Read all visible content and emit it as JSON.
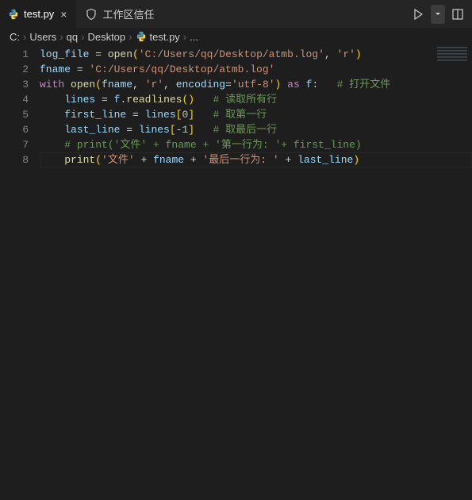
{
  "tab": {
    "filename": "test.py",
    "trust_label": "工作区信任"
  },
  "breadcrumbs": [
    "C:",
    "Users",
    "qq",
    "Desktop",
    "test.py",
    "..."
  ],
  "code": {
    "lines": [
      {
        "n": 1,
        "tokens": [
          {
            "t": "log_file",
            "c": "tok-var"
          },
          {
            "t": " = ",
            "c": "tok-op"
          },
          {
            "t": "open",
            "c": "tok-func"
          },
          {
            "t": "(",
            "c": "tok-pun"
          },
          {
            "t": "'C:/Users/qq/Desktop/atmb.log'",
            "c": "tok-str"
          },
          {
            "t": ", ",
            "c": "tok-op"
          },
          {
            "t": "'r'",
            "c": "tok-str"
          },
          {
            "t": ")",
            "c": "tok-pun"
          }
        ]
      },
      {
        "n": 2,
        "tokens": [
          {
            "t": "fname",
            "c": "tok-var"
          },
          {
            "t": " = ",
            "c": "tok-op"
          },
          {
            "t": "'C:/Users/qq/Desktop/atmb.log'",
            "c": "tok-str"
          }
        ]
      },
      {
        "n": 3,
        "tokens": [
          {
            "t": "with",
            "c": "tok-kw"
          },
          {
            "t": " ",
            "c": "tok-op"
          },
          {
            "t": "open",
            "c": "tok-func"
          },
          {
            "t": "(",
            "c": "tok-pun"
          },
          {
            "t": "fname",
            "c": "tok-var"
          },
          {
            "t": ", ",
            "c": "tok-op"
          },
          {
            "t": "'r'",
            "c": "tok-str"
          },
          {
            "t": ", ",
            "c": "tok-op"
          },
          {
            "t": "encoding",
            "c": "tok-var"
          },
          {
            "t": "=",
            "c": "tok-op"
          },
          {
            "t": "'utf-8'",
            "c": "tok-str"
          },
          {
            "t": ")",
            "c": "tok-pun"
          },
          {
            "t": " ",
            "c": "tok-op"
          },
          {
            "t": "as",
            "c": "tok-kw"
          },
          {
            "t": " ",
            "c": "tok-op"
          },
          {
            "t": "f",
            "c": "tok-var"
          },
          {
            "t": ":",
            "c": "tok-op"
          },
          {
            "t": "   ",
            "c": "tok-op"
          },
          {
            "t": "# 打开文件",
            "c": "tok-comment"
          }
        ]
      },
      {
        "n": 4,
        "tokens": [
          {
            "t": "    ",
            "c": "indent"
          },
          {
            "t": "lines",
            "c": "tok-var"
          },
          {
            "t": " = ",
            "c": "tok-op"
          },
          {
            "t": "f",
            "c": "tok-var"
          },
          {
            "t": ".",
            "c": "tok-op"
          },
          {
            "t": "readlines",
            "c": "tok-func"
          },
          {
            "t": "()",
            "c": "tok-pun"
          },
          {
            "t": "   ",
            "c": "tok-op"
          },
          {
            "t": "# 读取所有行",
            "c": "tok-comment"
          }
        ]
      },
      {
        "n": 5,
        "tokens": [
          {
            "t": "    ",
            "c": "indent"
          },
          {
            "t": "first_line",
            "c": "tok-var"
          },
          {
            "t": " = ",
            "c": "tok-op"
          },
          {
            "t": "lines",
            "c": "tok-var"
          },
          {
            "t": "[",
            "c": "tok-pun"
          },
          {
            "t": "0",
            "c": "tok-num"
          },
          {
            "t": "]",
            "c": "tok-pun"
          },
          {
            "t": "   ",
            "c": "tok-op"
          },
          {
            "t": "# 取第一行",
            "c": "tok-comment"
          }
        ]
      },
      {
        "n": 6,
        "tokens": [
          {
            "t": "    ",
            "c": "indent"
          },
          {
            "t": "last_line",
            "c": "tok-var"
          },
          {
            "t": " = ",
            "c": "tok-op"
          },
          {
            "t": "lines",
            "c": "tok-var"
          },
          {
            "t": "[",
            "c": "tok-pun"
          },
          {
            "t": "-",
            "c": "tok-op"
          },
          {
            "t": "1",
            "c": "tok-num"
          },
          {
            "t": "]",
            "c": "tok-pun"
          },
          {
            "t": "   ",
            "c": "tok-op"
          },
          {
            "t": "# 取最后一行",
            "c": "tok-comment"
          }
        ]
      },
      {
        "n": 7,
        "tokens": [
          {
            "t": "    ",
            "c": "indent"
          },
          {
            "t": "# print('文件' + fname + '第一行为: '+ first_line)",
            "c": "tok-comment"
          }
        ]
      },
      {
        "n": 8,
        "tokens": [
          {
            "t": "    ",
            "c": "indent"
          },
          {
            "t": "print",
            "c": "tok-func"
          },
          {
            "t": "(",
            "c": "tok-pun"
          },
          {
            "t": "'文件'",
            "c": "tok-str"
          },
          {
            "t": " + ",
            "c": "tok-op"
          },
          {
            "t": "fname",
            "c": "tok-var"
          },
          {
            "t": " + ",
            "c": "tok-op"
          },
          {
            "t": "'最后一行为: '",
            "c": "tok-str"
          },
          {
            "t": " + ",
            "c": "tok-op"
          },
          {
            "t": "last_line",
            "c": "tok-var"
          },
          {
            "t": ")",
            "c": "tok-pun"
          }
        ]
      }
    ],
    "highlight_line": 8
  }
}
